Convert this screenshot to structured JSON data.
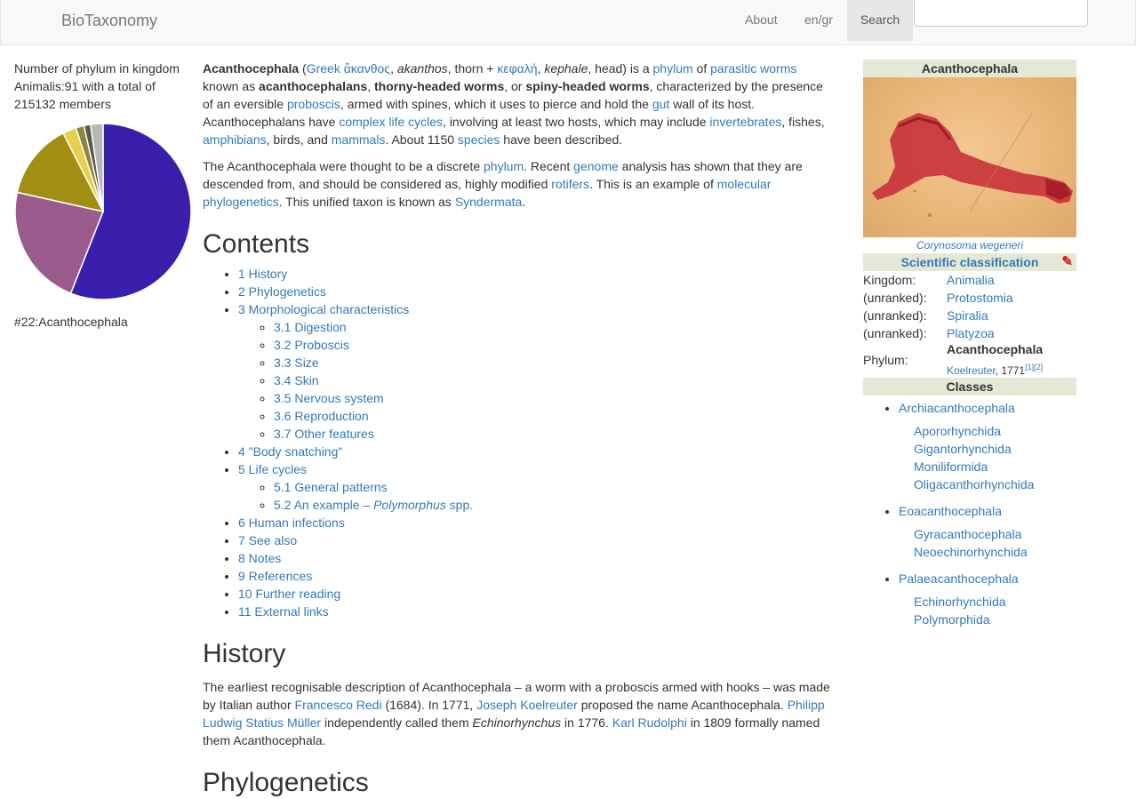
{
  "nav": {
    "brand": "BioTaxonomy",
    "about": "About",
    "lang": "en/gr",
    "search": "Search",
    "search_value": ""
  },
  "left": {
    "stats": "Number of phylum in kingdom Animalis:91 with a total of 215132 members",
    "caption": "#22:Acanthocephala",
    "slice_colors": [
      "#3a1eac",
      "#9a5c8c",
      "#a38e14",
      "#e9d04c",
      "#8c8440",
      "#5a5a48",
      "#b6b6b6"
    ]
  },
  "intro": {
    "p1": [
      {
        "t": "Acanthocephala",
        "b": true
      },
      {
        "t": " ("
      },
      {
        "t": "Greek ἄκανθος",
        "a": true
      },
      {
        "t": ", "
      },
      {
        "t": "akanthos",
        "i": true
      },
      {
        "t": ", thorn + "
      },
      {
        "t": "κεφαλή",
        "a": true
      },
      {
        "t": ", "
      },
      {
        "t": "kephale",
        "i": true
      },
      {
        "t": ", head) is a "
      },
      {
        "t": "phylum",
        "a": true
      },
      {
        "t": " of "
      },
      {
        "t": "parasitic worms",
        "a": true
      },
      {
        "t": " known as "
      },
      {
        "t": "acanthocephalans",
        "b": true
      },
      {
        "t": ", "
      },
      {
        "t": "thorny-headed worms",
        "b": true
      },
      {
        "t": ", or "
      },
      {
        "t": "spiny-headed worms",
        "b": true
      },
      {
        "t": ", characterized by the presence of an eversible "
      },
      {
        "t": "proboscis",
        "a": true
      },
      {
        "t": ", armed with spines, which it uses to pierce and hold the "
      },
      {
        "t": "gut",
        "a": true
      },
      {
        "t": " wall of its host. Acanthocephalans have "
      },
      {
        "t": "complex life cycles",
        "a": true
      },
      {
        "t": ", involving at least two hosts, which may include "
      },
      {
        "t": "invertebrates",
        "a": true
      },
      {
        "t": ", fishes, "
      },
      {
        "t": "amphibians",
        "a": true
      },
      {
        "t": ", birds, and "
      },
      {
        "t": "mammals",
        "a": true
      },
      {
        "t": ". About 1150 "
      },
      {
        "t": "species",
        "a": true
      },
      {
        "t": " have been described."
      }
    ],
    "p2": [
      {
        "t": "The Acanthocephala were thought to be a discrete "
      },
      {
        "t": "phylum",
        "a": true
      },
      {
        "t": ". Recent "
      },
      {
        "t": "genome",
        "a": true
      },
      {
        "t": " analysis has shown that they are descended from, and should be considered as, highly modified "
      },
      {
        "t": "rotifers",
        "a": true
      },
      {
        "t": ". This is an example of "
      },
      {
        "t": "molecular phylogenetics",
        "a": true
      },
      {
        "t": ". This unified taxon is known as "
      },
      {
        "t": "Syndermata",
        "a": true
      },
      {
        "t": "."
      }
    ]
  },
  "toc": {
    "title": "Contents",
    "items": [
      {
        "label": "1 History"
      },
      {
        "label": "2 Phylogenetics"
      },
      {
        "label": "3 Morphological characteristics",
        "children": [
          {
            "label": "3.1 Digestion"
          },
          {
            "label": "3.2 Proboscis"
          },
          {
            "label": "3.3 Size"
          },
          {
            "label": "3.4 Skin"
          },
          {
            "label": "3.5 Nervous system"
          },
          {
            "label": "3.6 Reproduction"
          },
          {
            "label": "3.7 Other features"
          }
        ]
      },
      {
        "label": "4 \"Body snatching\""
      },
      {
        "label": "5 Life cycles",
        "children": [
          {
            "label": "5.1 General patterns"
          },
          {
            "label": "5.2 An example – ",
            "italic": "Polymorphus",
            "suffix": " spp."
          }
        ]
      },
      {
        "label": "6 Human infections"
      },
      {
        "label": "7 See also"
      },
      {
        "label": "8 Notes"
      },
      {
        "label": "9 References"
      },
      {
        "label": "10 Further reading"
      },
      {
        "label": "11 External links"
      }
    ]
  },
  "history": {
    "title": "History",
    "p": [
      {
        "t": "The earliest recognisable description of Acanthocephala – a worm with a proboscis armed with hooks – was made by Italian author "
      },
      {
        "t": "Francesco Redi",
        "a": true
      },
      {
        "t": " (1684). In 1771, "
      },
      {
        "t": "Joseph Koelreuter",
        "a": true
      },
      {
        "t": " proposed the name Acanthocephala. "
      },
      {
        "t": "Philipp Ludwig Statius Müller",
        "a": true
      },
      {
        "t": " independently called them "
      },
      {
        "t": "Echinorhynchus",
        "i": true
      },
      {
        "t": " in 1776. "
      },
      {
        "t": "Karl Rudolphi",
        "a": true
      },
      {
        "t": " in 1809 formally named them Acanthocephala."
      }
    ]
  },
  "next_heading": "Phylogenetics",
  "infobox": {
    "title": "Acanthocephala",
    "image_caption": "Corynosoma wegeneri",
    "sci_header": "Scientific classification",
    "rows": [
      {
        "label": "Kingdom:",
        "value": "Animalia"
      },
      {
        "label": "(unranked):",
        "value": "Protostomia"
      },
      {
        "label": "(unranked):",
        "value": "Spiralia"
      },
      {
        "label": "(unranked):",
        "value": "Platyzoa"
      }
    ],
    "phylum_label": "Phylum:",
    "phylum_name": "Acanthocephala",
    "phylum_author": "Koelreuter",
    "phylum_year": ", 1771",
    "phylum_ref1": "[1]",
    "phylum_ref2": "[2]",
    "classes_header": "Classes",
    "classes": [
      {
        "name": "Archiacanthocephala",
        "orders": [
          "Apororhynchida",
          "Gigantorhynchida",
          "Moniliformida",
          "Oligacanthorhynchida"
        ]
      },
      {
        "name": "Eoacanthocephala",
        "orders": [
          "Gyracanthocephala",
          "Neoechinorhynchida"
        ]
      },
      {
        "name": "Palaeacanthocephala",
        "orders": [
          "Echinorhynchida",
          "Polymorphida"
        ]
      }
    ]
  }
}
